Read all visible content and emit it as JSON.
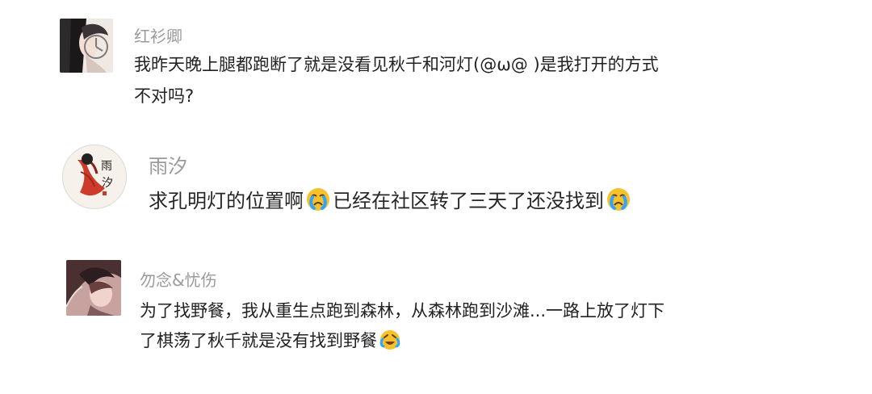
{
  "comments": [
    {
      "username": "红衫卿",
      "lines": [
        "我昨天晚上腿都跑断了就是没看见秋千和河灯(@ω@ )是我打开的方式",
        "不对吗?"
      ]
    },
    {
      "username": "雨汐",
      "text_parts": [
        "求孔明灯的位置啊",
        "已经在社区转了三天了还没找到"
      ],
      "avatar_text": "雨汐",
      "emoji": [
        "crying-face-icon",
        "crying-face-icon"
      ]
    },
    {
      "username": "勿念&忧伤",
      "lines": [
        "为了找野餐，我从重生点跑到森林，从森林跑到沙滩...一路上放了灯下",
        "了棋荡了秋千就是没有找到野餐"
      ],
      "emoji": [
        "laughing-crying-face-icon"
      ]
    }
  ],
  "colors": {
    "username": "#9a9a9a",
    "text": "#222222",
    "emoji": "#f6c12a"
  }
}
